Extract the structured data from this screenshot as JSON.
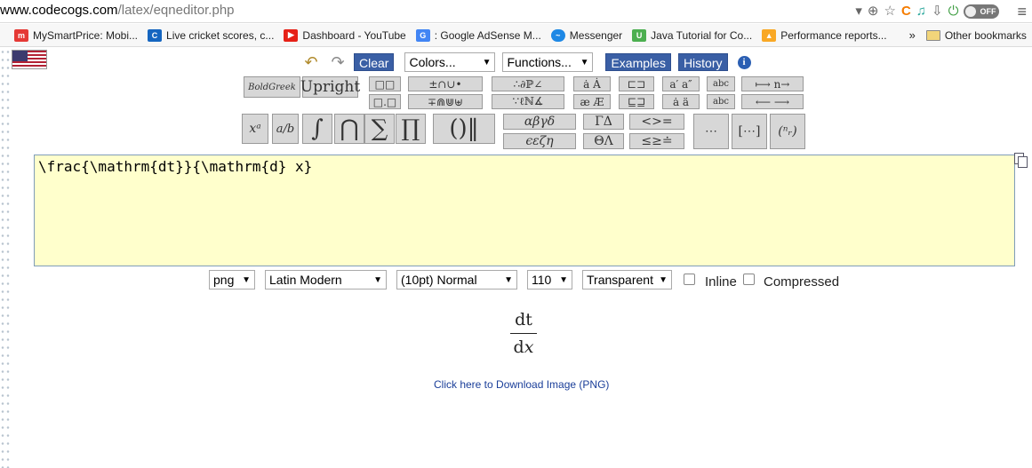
{
  "browser": {
    "url_domain": "www.codecogs.com",
    "url_path": "/latex/eqneditor.php",
    "toggle_label": "OFF",
    "bookmarks": [
      {
        "label": "MySmartPrice: Mobi...",
        "icon": "mysmartprice-icon",
        "color": "#e53935"
      },
      {
        "label": "Live cricket scores, c...",
        "icon": "cricbuzz-icon",
        "color": "#1565c0"
      },
      {
        "label": "Dashboard - YouTube",
        "icon": "youtube-icon",
        "color": "#e62117"
      },
      {
        "label": ": Google AdSense M...",
        "icon": "google-icon",
        "color": "#4285f4"
      },
      {
        "label": "Messenger",
        "icon": "messenger-icon",
        "color": "#1e88e5"
      },
      {
        "label": "Java Tutorial for Co...",
        "icon": "udemy-icon",
        "color": "#4caf50"
      },
      {
        "label": "Performance reports...",
        "icon": "analytics-icon",
        "color": "#f9a825"
      }
    ],
    "more_label": "»",
    "other_bookmarks": "Other bookmarks"
  },
  "toolbar": {
    "clear_label": "Clear",
    "colors_label": "Colors...",
    "functions_label": "Functions...",
    "examples_label": "Examples",
    "history_label": "History",
    "boldgreek_label": "BoldGreek",
    "upright_label": "Upright"
  },
  "editor": {
    "latex": "\\frac{\\mathrm{dt}}{\\mathrm{d} x}"
  },
  "options": {
    "format": "png",
    "font": "Latin Modern",
    "size": "(10pt) Normal",
    "dpi": "110",
    "background": "Transparent",
    "inline_label": "Inline",
    "compressed_label": "Compressed"
  },
  "output": {
    "numerator": "dt",
    "denominator_d": "d",
    "denominator_x": "x",
    "download_label": "Click here to Download Image (PNG)"
  },
  "colors": {
    "editor_bg": "#ffffcc",
    "button_blue": "#3a5fa5",
    "link": "#1a3e99"
  }
}
